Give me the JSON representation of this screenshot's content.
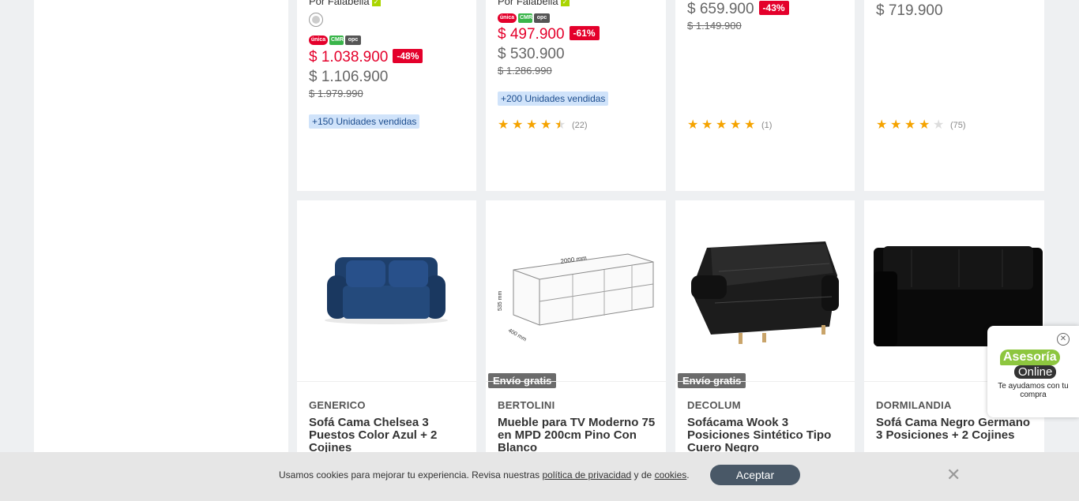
{
  "products_top": [
    {
      "seller": "Por Falabella",
      "has_swatch": true,
      "price": "$ 1.038.900",
      "discount": "-48%",
      "price_cmr": "$ 1.106.900",
      "price_old": "$ 1.979.990",
      "sold": "+150 Unidades vendidas"
    },
    {
      "seller": "Por Falabella",
      "price": "$ 497.900",
      "discount": "-61%",
      "price_cmr": "$ 530.900",
      "price_old": "$ 1.286.990",
      "sold": "+200 Unidades vendidas",
      "rating": 4.5,
      "reviews": "(22)"
    },
    {
      "price": "$ 659.900",
      "discount": "-43%",
      "price_old": "$ 1.149.900",
      "rating": 5,
      "reviews": "(1)"
    },
    {
      "price": "$ 719.900",
      "rating": 4,
      "reviews": "(75)"
    }
  ],
  "products_bottom": [
    {
      "brand": "GENERICO",
      "title": "Sofá Cama Chelsea 3 Puestos Color Azul + 2 Cojines"
    },
    {
      "brand": "BERTOLINI",
      "title": "Mueble para TV Moderno 75 en MPD 200cm Pino Con Blanco",
      "shipping": "Envío gratis"
    },
    {
      "brand": "DECOLUM",
      "title": "Sofácama Wook 3 Posiciones Sintético Tipo Cuero Negro",
      "shipping": "Envío gratis"
    },
    {
      "brand": "DORMILANDIA",
      "title": "Sofá Cama Negro Germano 3 Posiciones + 2 Cojines"
    }
  ],
  "chat": {
    "line1": "Asesoría",
    "line2": "Online",
    "subtitle": "Te ayudamos con tu compra"
  },
  "cookie": {
    "text_before": "Usamos cookies para mejorar tu experiencia. Revisa nuestras ",
    "privacy_link": "política de privacidad",
    "text_middle": " y de ",
    "cookies_link": "cookies",
    "text_after": ".",
    "accept": "Aceptar"
  },
  "logos": {
    "unica": "única",
    "cmr": "CMR",
    "opc": "opc"
  },
  "tv_dims": {
    "width": "2000 mm",
    "height": "535 mm",
    "depth": "400 mm"
  }
}
